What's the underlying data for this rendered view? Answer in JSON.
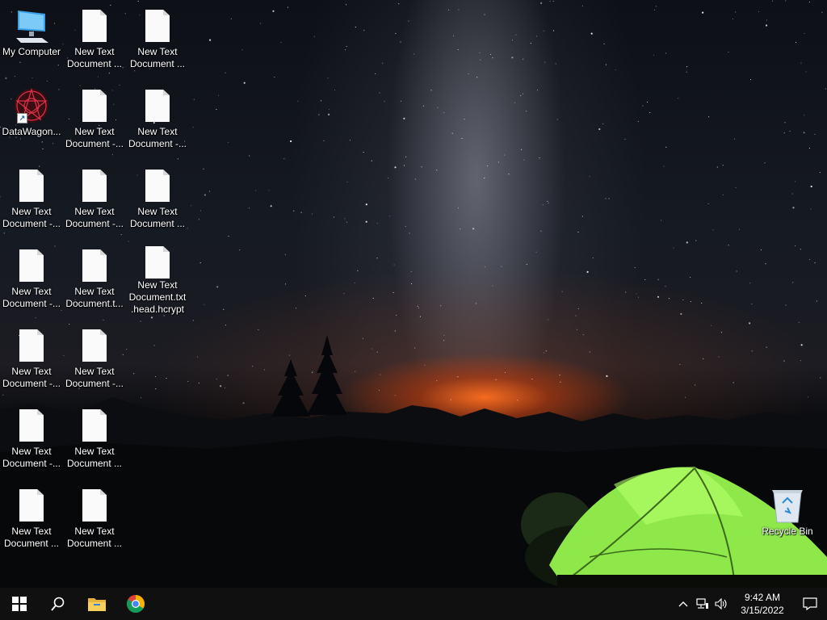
{
  "desktop": {
    "icons": [
      {
        "label": "My Computer",
        "icon": "computer-icon"
      },
      {
        "label": "New Text\nDocument ...",
        "icon": "text-file-icon"
      },
      {
        "label": "New Text\nDocument ...",
        "icon": "text-file-icon"
      },
      {
        "label": "DataWagon...",
        "icon": "datawagon-icon"
      },
      {
        "label": "New Text\nDocument -...",
        "icon": "text-file-icon"
      },
      {
        "label": "New Text\nDocument -...",
        "icon": "text-file-icon"
      },
      {
        "label": "New Text\nDocument -...",
        "icon": "text-file-icon"
      },
      {
        "label": "New Text\nDocument -...",
        "icon": "text-file-icon"
      },
      {
        "label": "New Text\nDocument ...",
        "icon": "text-file-icon"
      },
      {
        "label": "New Text\nDocument -...",
        "icon": "text-file-icon"
      },
      {
        "label": "New Text\nDocument.t...",
        "icon": "text-file-icon"
      },
      {
        "label": "New Text\nDocument.txt\n.head.hcrypt",
        "icon": "text-file-icon"
      },
      {
        "label": "New Text\nDocument -...",
        "icon": "text-file-icon"
      },
      {
        "label": "New Text\nDocument -...",
        "icon": "text-file-icon"
      },
      {
        "label": "New Text\nDocument -...",
        "icon": "text-file-icon"
      },
      {
        "label": "New Text\nDocument ...",
        "icon": "text-file-icon"
      },
      {
        "label": "New Text\nDocument ...",
        "icon": "text-file-icon"
      },
      {
        "label": "New Text\nDocument ...",
        "icon": "text-file-icon"
      },
      {
        "label": "Recycle Bin",
        "icon": "recycle-bin-icon"
      }
    ]
  },
  "taskbar": {
    "start": "windows-start-icon",
    "search": "search-icon",
    "pinned": [
      "file-explorer-icon",
      "chrome-icon"
    ],
    "tray": [
      "chevron-up-icon",
      "network-icon",
      "volume-icon"
    ],
    "time": "9:42 AM",
    "date": "3/15/2022",
    "notification": "notification-icon"
  },
  "colors": {
    "taskbar": "#101010",
    "sky_glow": "#ff6e1e",
    "tent": "#8fe84a"
  }
}
